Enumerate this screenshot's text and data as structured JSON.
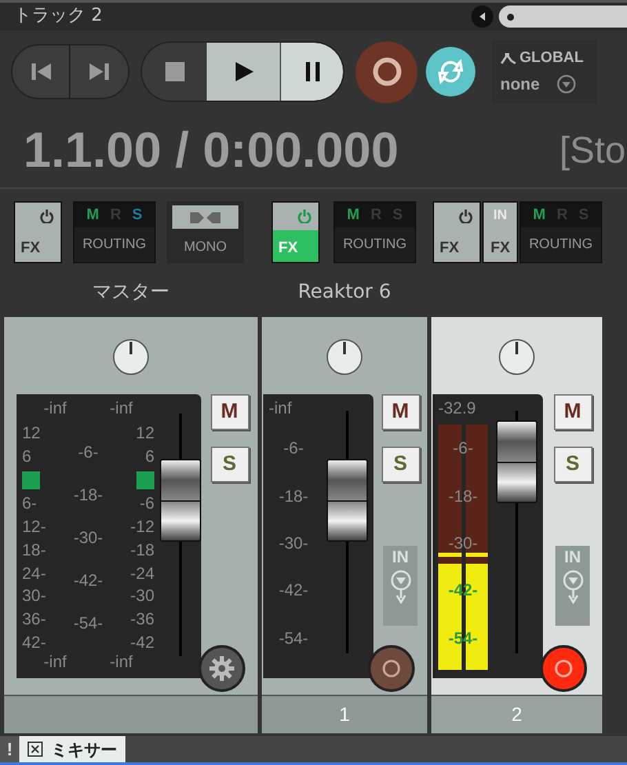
{
  "title": "トラック 2",
  "transport": {
    "recording": false,
    "repeat": true
  },
  "automation": {
    "label": "GLOBAL",
    "value": "none"
  },
  "time": "1.1.00 / 0:00.000",
  "status": "[Sto",
  "strips": [
    {
      "kind": "master",
      "name": "マスター",
      "fx_active": false,
      "routing": [
        {
          "label": "M",
          "color": "#1fa050"
        },
        {
          "label": "R",
          "color": "#3a3a3a"
        },
        {
          "label": "S",
          "color": "#1e7aa0"
        }
      ],
      "routing_label": "ROUTING",
      "mono_label": "MONO",
      "fx_label": "FX",
      "selected": false,
      "readouts_top": [
        "-inf",
        "-inf"
      ],
      "readouts_bottom": [
        "-inf",
        "-inf"
      ],
      "scale_left": [
        {
          "text": "12"
        },
        {
          "text": "6"
        },
        {
          "kind": "peak"
        },
        {
          "text": "6-"
        },
        {
          "text": "12-"
        },
        {
          "text": "18-"
        },
        {
          "text": "24-"
        },
        {
          "text": "30-"
        },
        {
          "text": "36-"
        },
        {
          "text": "42-"
        }
      ],
      "scale_mid": [
        "-6-",
        "-18-",
        "-30-",
        "-42-",
        "-54-"
      ],
      "scale_right": [
        {
          "text": "12"
        },
        {
          "text": "6"
        },
        {
          "kind": "peak"
        },
        {
          "text": "-6"
        },
        {
          "text": "-12"
        },
        {
          "text": "-18"
        },
        {
          "text": "-24"
        },
        {
          "text": "-30"
        },
        {
          "text": "-36"
        },
        {
          "text": "-42"
        }
      ],
      "fader": {
        "level": 0.64
      },
      "mute": "M",
      "solo": "S"
    },
    {
      "kind": "track",
      "name": "Reaktor 6",
      "fx_active": true,
      "input_fx": false,
      "routing": [
        {
          "label": "M",
          "color": "#1fa050"
        },
        {
          "label": "R",
          "color": "#3a3a3a"
        },
        {
          "label": "S",
          "color": "#3a3a3a"
        }
      ],
      "routing_label": "ROUTING",
      "fx_label": "FX",
      "selected": false,
      "readout": "-inf",
      "scale": [
        "-6-",
        "-18-",
        "-30-",
        "-42-",
        "-54-"
      ],
      "fader": {
        "level": 0.63
      },
      "mute": "M",
      "solo": "S",
      "input_label": "IN",
      "armed": false,
      "number": "1"
    },
    {
      "kind": "track",
      "fx_active": false,
      "input_fx": true,
      "input_fx_labels": [
        "IN",
        "FX"
      ],
      "routing": [
        {
          "label": "M",
          "color": "#1fa050"
        },
        {
          "label": "R",
          "color": "#3a3a3a"
        },
        {
          "label": "S",
          "color": "#3a3a3a"
        }
      ],
      "routing_label": "ROUTING",
      "fx_label": "FX",
      "selected": true,
      "readout": "-32.9",
      "scale": [
        "-6-",
        "-18-",
        "-30-",
        "-42-",
        "-54-"
      ],
      "meter": {
        "level": 0.43
      },
      "fader": {
        "level": 0.79
      },
      "mute": "M",
      "solo": "S",
      "input_label": "IN",
      "armed": true,
      "number": "2"
    }
  ],
  "tabs": [
    {
      "label": "ミキサー",
      "selected": true
    }
  ],
  "alert": "!"
}
